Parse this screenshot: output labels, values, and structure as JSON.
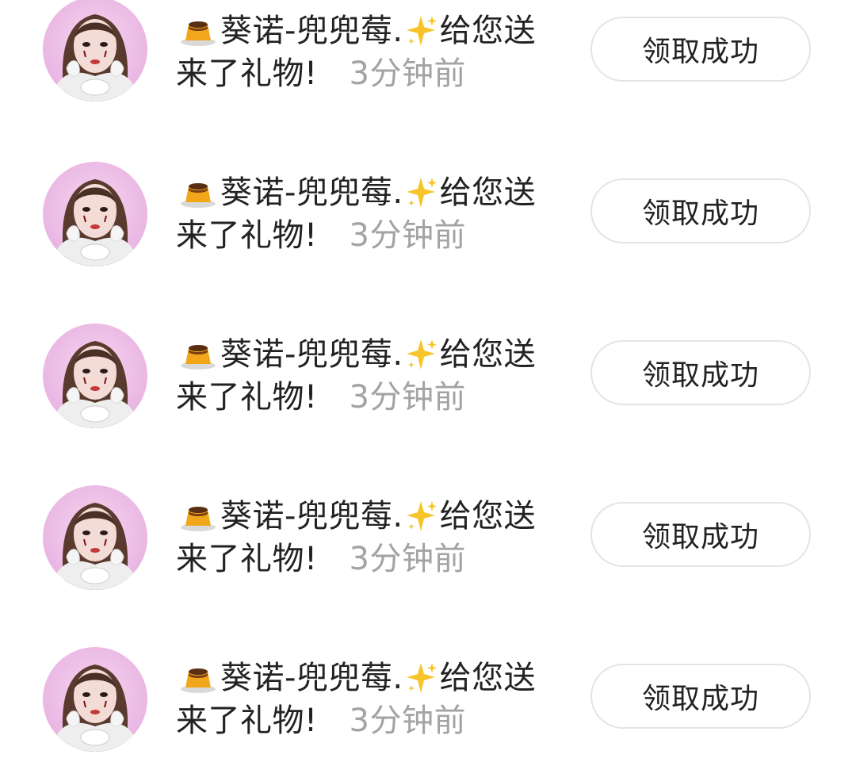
{
  "notifications": [
    {
      "sender": "葵诺-兜兜莓.",
      "message_tail": "给您送",
      "message_line2": "来了礼物!",
      "time": "3分钟前",
      "button_label": "领取成功",
      "avatar_icon": "user-avatar",
      "emoji_before": "custard-pudding-emoji",
      "emoji_after": "sparkles-emoji"
    },
    {
      "sender": "葵诺-兜兜莓.",
      "message_tail": "给您送",
      "message_line2": "来了礼物!",
      "time": "3分钟前",
      "button_label": "领取成功",
      "avatar_icon": "user-avatar",
      "emoji_before": "custard-pudding-emoji",
      "emoji_after": "sparkles-emoji"
    },
    {
      "sender": "葵诺-兜兜莓.",
      "message_tail": "给您送",
      "message_line2": "来了礼物!",
      "time": "3分钟前",
      "button_label": "领取成功",
      "avatar_icon": "user-avatar",
      "emoji_before": "custard-pudding-emoji",
      "emoji_after": "sparkles-emoji"
    },
    {
      "sender": "葵诺-兜兜莓.",
      "message_tail": "给您送",
      "message_line2": "来了礼物!",
      "time": "3分钟前",
      "button_label": "领取成功",
      "avatar_icon": "user-avatar",
      "emoji_before": "custard-pudding-emoji",
      "emoji_after": "sparkles-emoji"
    },
    {
      "sender": "葵诺-兜兜莓.",
      "message_tail": "给您送",
      "message_line2": "来了礼物!",
      "time": "3分钟前",
      "button_label": "领取成功",
      "avatar_icon": "user-avatar",
      "emoji_before": "custard-pudding-emoji",
      "emoji_after": "sparkles-emoji"
    }
  ],
  "colors": {
    "text": "#222222",
    "time": "#a3a3a3",
    "button_border": "#e4e4e4",
    "avatar_bg": "#e9b6e3"
  }
}
